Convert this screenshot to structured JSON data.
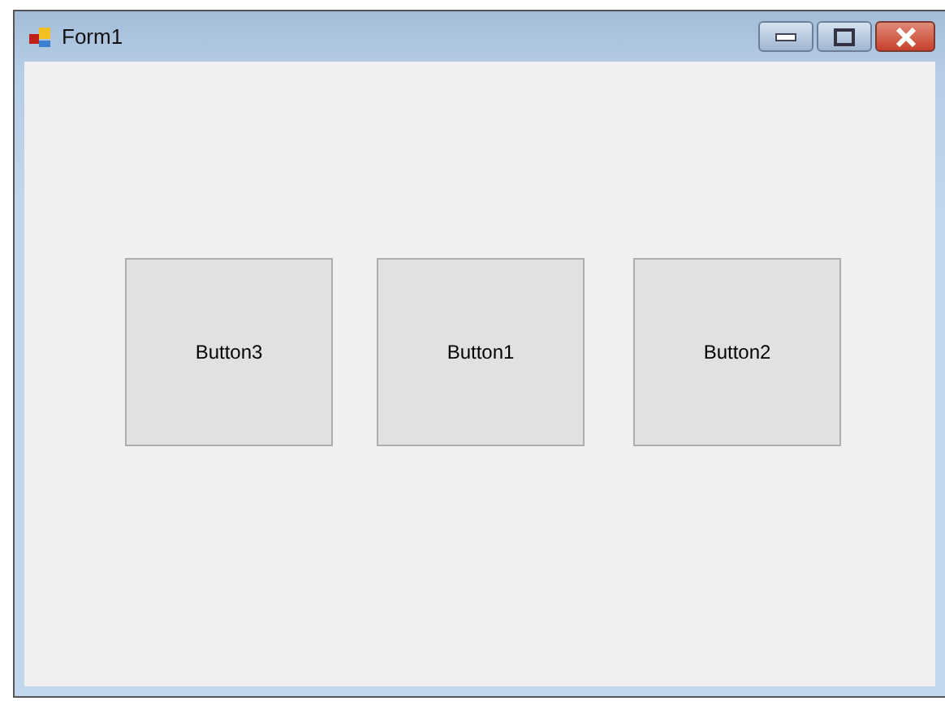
{
  "window": {
    "title": "Form1"
  },
  "buttons": [
    "Button3",
    "Button1",
    "Button2"
  ]
}
